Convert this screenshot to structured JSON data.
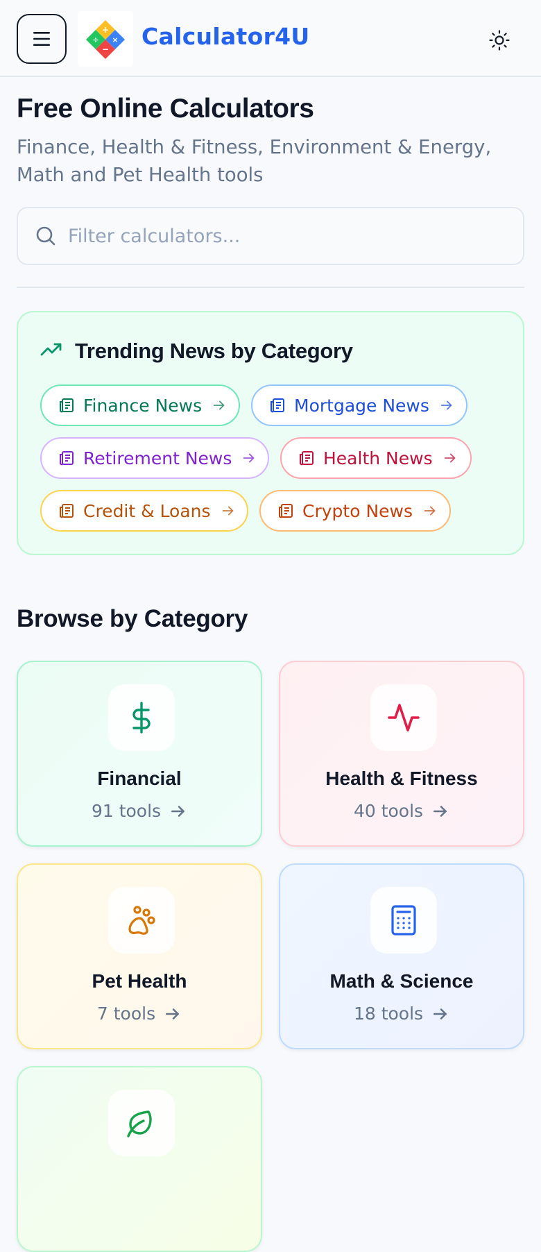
{
  "header": {
    "brand": "Calculator4U",
    "menu_icon": "hamburger-icon",
    "theme_icon": "sun-icon"
  },
  "hero": {
    "title": "Free Online Calculators",
    "subtitle": "Finance, Health & Fitness, Environment & Energy, Math and Pet Health tools"
  },
  "search": {
    "placeholder": "Filter calculators...",
    "value": ""
  },
  "trending": {
    "title": "Trending News by Category",
    "chips": [
      {
        "label": "Finance News",
        "color": "#047857",
        "border": "#6ee7b7"
      },
      {
        "label": "Mortgage News",
        "color": "#1d4ed8",
        "border": "#93c5fd"
      },
      {
        "label": "Retirement News",
        "color": "#7e22ce",
        "border": "#d8b4fe"
      },
      {
        "label": "Health News",
        "color": "#be123c",
        "border": "#fda4af"
      },
      {
        "label": "Credit & Loans",
        "color": "#b45309",
        "border": "#fcd34d"
      },
      {
        "label": "Crypto News",
        "color": "#c2410c",
        "border": "#fdba74"
      }
    ]
  },
  "browse": {
    "title": "Browse by Category",
    "categories": [
      {
        "name": "Financial",
        "count": "91 tools",
        "icon": "dollar-icon",
        "color": "#059669"
      },
      {
        "name": "Health & Fitness",
        "count": "40 tools",
        "icon": "activity-icon",
        "color": "#e11d48"
      },
      {
        "name": "Pet Health",
        "count": "7 tools",
        "icon": "paw-icon",
        "color": "#d97706"
      },
      {
        "name": "Math & Science",
        "count": "18 tools",
        "icon": "calculator-icon",
        "color": "#2563eb"
      },
      {
        "name": "",
        "count": "",
        "icon": "leaf-icon",
        "color": "#16a34a"
      }
    ]
  }
}
